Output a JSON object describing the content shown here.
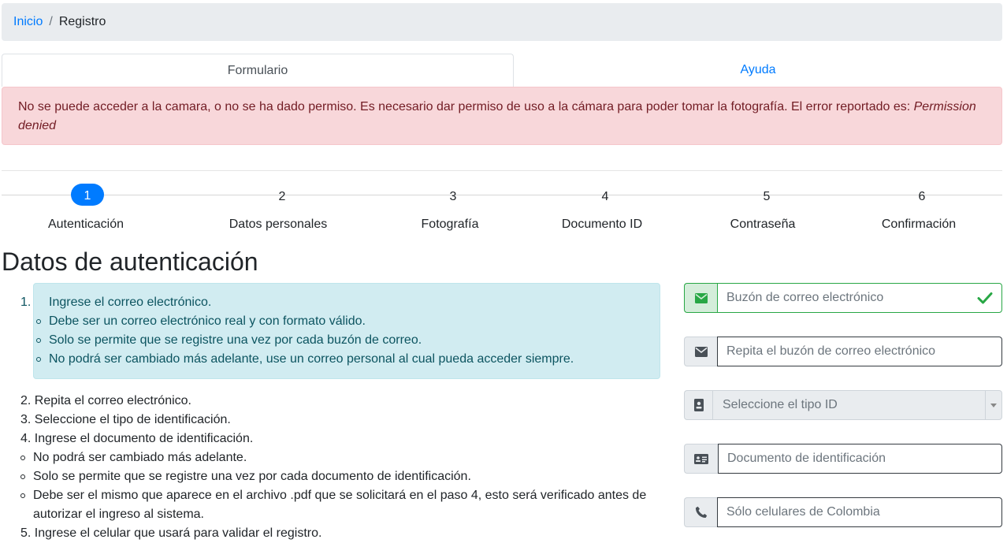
{
  "breadcrumb": {
    "home": "Inicio",
    "separator": "/",
    "current": "Registro"
  },
  "tabs": {
    "form": "Formulario",
    "help": "Ayuda"
  },
  "alert": {
    "text": "No se puede acceder a la camara, o no se ha dado permiso. Es necesario dar permiso de uso a la cámara para poder tomar la fotografía. El error reportado es: ",
    "error": "Permission denied"
  },
  "steps": [
    {
      "num": "1",
      "label": "Autenticación",
      "active": true
    },
    {
      "num": "2",
      "label": "Datos personales"
    },
    {
      "num": "3",
      "label": "Fotografía"
    },
    {
      "num": "4",
      "label": "Documento ID"
    },
    {
      "num": "5",
      "label": "Contraseña"
    },
    {
      "num": "6",
      "label": "Confirmación"
    }
  ],
  "section_title": "Datos de autenticación",
  "instructions": {
    "item1_num": "1.",
    "item1": "Ingrese el correo electrónico.",
    "item1_bullets": [
      "Debe ser un correo electrónico real y con formato válido.",
      "Solo se permite que se registre una vez por cada buzón de correo.",
      "No podrá ser cambiado más adelante, use un correo personal al cual pueda acceder siempre."
    ],
    "item2": "2. Repita el correo electrónico.",
    "item3": "3. Seleccione el tipo de identificación.",
    "item4": "4. Ingrese el documento de identificación.",
    "item4_bullets": [
      "No podrá ser cambiado más adelante.",
      "Solo se permite que se registre una vez por cada documento de identificación.",
      "Debe ser el mismo que aparece en el archivo .pdf que se solicitará en el paso 4, esto será verificado antes de"
    ],
    "item4_bullet3_cont": "autorizar el ingreso al sistema.",
    "item5": "5. Ingrese el celular que usará para validar el registro."
  },
  "form": {
    "email_placeholder": "Buzón de correo electrónico",
    "email_repeat_placeholder": "Repita el buzón de correo electrónico",
    "id_type_placeholder": "Seleccione el tipo ID",
    "id_document_placeholder": "Documento de identificación",
    "phone_placeholder": "Sólo celulares de Colombia"
  },
  "colors": {
    "primary": "#007bff",
    "success": "#28a745",
    "danger_bg": "#f8d7da",
    "info_bg": "#d1ecf1"
  }
}
